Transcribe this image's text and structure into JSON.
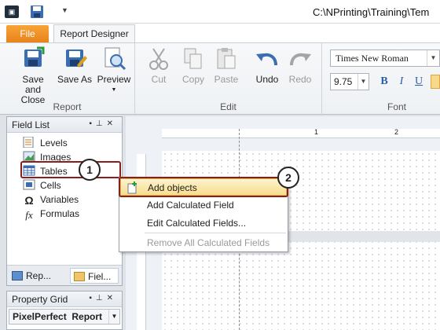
{
  "window": {
    "title": "C:\\NPrinting\\Training\\Tem"
  },
  "tabs": {
    "file": "File",
    "report_designer": "Report Designer"
  },
  "ribbon": {
    "report_group": {
      "label": "Report",
      "save_close": "Save and Close",
      "save_as": "Save As",
      "preview": "Preview"
    },
    "edit_group": {
      "label": "Edit",
      "cut": "Cut",
      "copy": "Copy",
      "paste": "Paste",
      "undo": "Undo",
      "redo": "Redo"
    },
    "font_group": {
      "label": "Font",
      "font_name": "Times New Roman",
      "font_size": "9.75",
      "bold": "B",
      "italic": "I",
      "underline": "U"
    }
  },
  "field_list": {
    "title": "Field List",
    "items": [
      {
        "label": "Levels",
        "icon": "levels-icon"
      },
      {
        "label": "Images",
        "icon": "images-icon"
      },
      {
        "label": "Tables",
        "icon": "table-icon"
      },
      {
        "label": "Cells",
        "icon": "cells-icon"
      },
      {
        "label": "Variables",
        "icon": "omega-icon"
      },
      {
        "label": "Formulas",
        "icon": "fx-icon"
      }
    ],
    "bottom_tabs": [
      "Rep...",
      "Fiel..."
    ]
  },
  "property_grid": {
    "title": "Property Grid",
    "selected": "PixelPerfect  Report"
  },
  "context_menu": {
    "items": [
      {
        "label": "Add objects",
        "state": "highlighted"
      },
      {
        "label": "Add Calculated Field",
        "state": "normal"
      },
      {
        "label": "Edit Calculated Fields...",
        "state": "normal"
      },
      {
        "label": "Remove All Calculated Fields",
        "state": "disabled"
      }
    ]
  },
  "ruler": {
    "top_marks": [
      "1",
      "2"
    ]
  },
  "callouts": [
    "1",
    "2"
  ],
  "colors": {
    "accent_file_tab": "#e8831b",
    "callout_border": "#8c1d1d",
    "menu_highlight": "#f8dd8c"
  }
}
